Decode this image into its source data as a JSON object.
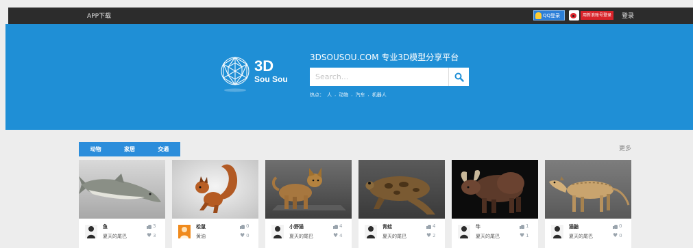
{
  "topbar": {
    "app_download": "APP下载",
    "qq_login": "QQ登录",
    "weibo_login": "用新浪账号登录",
    "login": "登录"
  },
  "hero": {
    "logo_3d": "3D",
    "logo_sousou": "Sou Sou",
    "slogan": "3DSOUSOU.COM 专业3D模型分享平台",
    "search_placeholder": "Search...",
    "hot_label": "热点：",
    "hot_tags": [
      "人",
      "动物",
      "汽车",
      "机器人"
    ]
  },
  "content": {
    "tabs": [
      "动物",
      "家居",
      "交通"
    ],
    "more": "更多"
  },
  "models": [
    {
      "name": "鱼",
      "author": "夏天的尾巴",
      "likes": "3",
      "favs": "3"
    },
    {
      "name": "松鼠",
      "author": "黄油",
      "likes": "0",
      "favs": "0"
    },
    {
      "name": "小野猫",
      "author": "夏天的尾巴",
      "likes": "4",
      "favs": "4"
    },
    {
      "name": "青蛙",
      "author": "夏天的尾巴",
      "likes": "4",
      "favs": "2"
    },
    {
      "name": "牛",
      "author": "夏天的尾巴",
      "likes": "1",
      "favs": "1"
    },
    {
      "name": "猫鼬",
      "author": "夏天的尾巴",
      "likes": "0",
      "favs": "0"
    }
  ],
  "colors": {
    "topbar": "#2c2c2c",
    "hero": "#1f8fd6",
    "tabs": "#2b8ddb",
    "background": "#ededed"
  },
  "icons": {
    "search": "search-icon",
    "like": "thumbs-up-icon",
    "fav": "heart-icon",
    "qq": "qq-icon",
    "weibo": "weibo-icon",
    "logo": "geodesic-sphere-icon"
  }
}
